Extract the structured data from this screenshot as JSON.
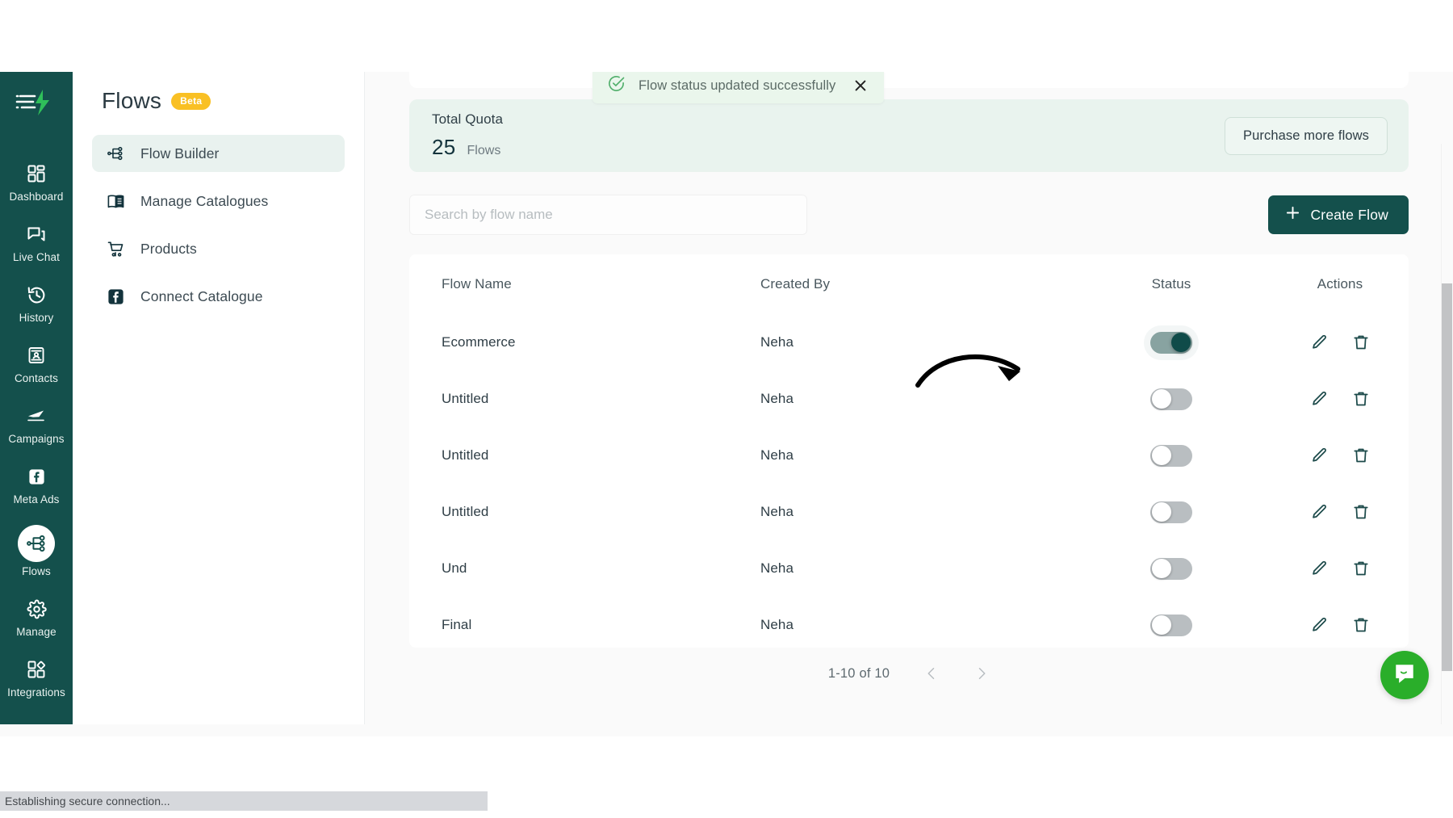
{
  "rail": {
    "logo_icon": "flows-logo-icon",
    "items": [
      {
        "label": "Dashboard",
        "icon": "dashboard-icon",
        "active": false
      },
      {
        "label": "Live Chat",
        "icon": "chat-icon",
        "active": false
      },
      {
        "label": "History",
        "icon": "history-icon",
        "active": false
      },
      {
        "label": "Contacts",
        "icon": "contacts-icon",
        "active": false
      },
      {
        "label": "Campaigns",
        "icon": "campaigns-icon",
        "active": false
      },
      {
        "label": "Meta Ads",
        "icon": "facebook-icon",
        "active": false
      },
      {
        "label": "Flows",
        "icon": "flows-icon",
        "active": true
      },
      {
        "label": "Manage",
        "icon": "gear-icon",
        "active": false
      },
      {
        "label": "Integrations",
        "icon": "integrations-icon",
        "active": false
      }
    ]
  },
  "subnav": {
    "title": "Flows",
    "badge": "Beta",
    "items": [
      {
        "label": "Flow Builder",
        "icon": "flow-builder-icon",
        "active": true
      },
      {
        "label": "Manage Catalogues",
        "icon": "book-icon",
        "active": false
      },
      {
        "label": "Products",
        "icon": "cart-icon",
        "active": false
      },
      {
        "label": "Connect Catalogue",
        "icon": "facebook-square-icon",
        "active": false
      }
    ]
  },
  "toast": {
    "message": "Flow status updated successfully",
    "icon": "check-circle-icon",
    "close_icon": "close-icon"
  },
  "quota": {
    "label": "Total Quota",
    "value": "25",
    "unit": "Flows",
    "purchase_label": "Purchase more flows"
  },
  "search": {
    "placeholder": "Search by flow name",
    "value": ""
  },
  "create": {
    "label": "Create Flow",
    "icon": "plus-icon"
  },
  "table": {
    "columns": [
      "Flow Name",
      "Created By",
      "Status",
      "Actions"
    ],
    "rows": [
      {
        "name": "Ecommerce",
        "created_by": "Neha",
        "status": true
      },
      {
        "name": "Untitled",
        "created_by": "Neha",
        "status": false
      },
      {
        "name": "Untitled",
        "created_by": "Neha",
        "status": false
      },
      {
        "name": "Untitled",
        "created_by": "Neha",
        "status": false
      },
      {
        "name": "Und",
        "created_by": "Neha",
        "status": false
      },
      {
        "name": "Final",
        "created_by": "Neha",
        "status": false
      }
    ],
    "row_actions": [
      "edit-icon",
      "delete-icon"
    ]
  },
  "pagination": {
    "range_text": "1-10 of 10",
    "prev_icon": "chevron-left-icon",
    "next_icon": "chevron-right-icon"
  },
  "chat": {
    "icon": "messenger-icon"
  },
  "statusbar": {
    "text": "Establishing secure connection..."
  },
  "annotation": {
    "arrow_icon": "curved-arrow-icon"
  },
  "colors": {
    "brand_dark": "#14504c",
    "badge_yellow": "#f9c024",
    "toast_bg": "#eaf6ec",
    "quota_bg": "#e9f3ee",
    "chat_green": "#2aae2a"
  }
}
